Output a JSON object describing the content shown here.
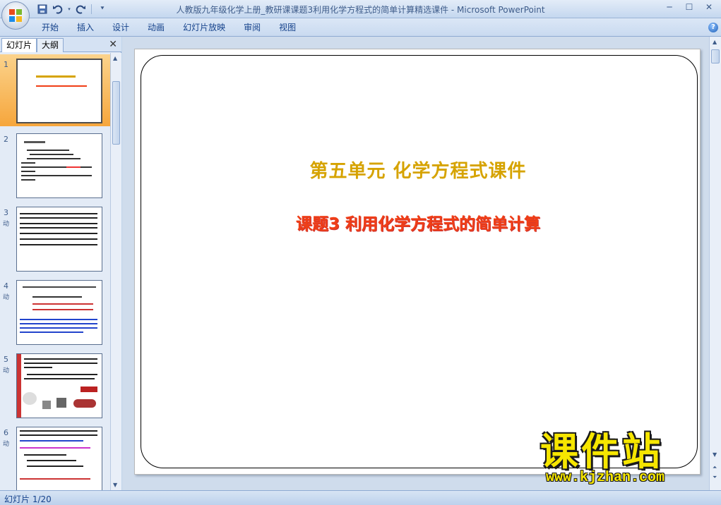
{
  "window": {
    "title": "人教版九年级化学上册_教研课课题3利用化学方程式的简单计算精选课件 - Microsoft PowerPoint"
  },
  "quick_access": [
    "save-icon",
    "undo-icon",
    "redo-icon",
    "customize-icon"
  ],
  "ribbon": {
    "tabs": [
      "开始",
      "插入",
      "设计",
      "动画",
      "幻灯片放映",
      "审阅",
      "视图"
    ]
  },
  "left_panel": {
    "tab_slides": "幻灯片",
    "tab_outline": "大纲",
    "close": "✕",
    "thumbnails": [
      {
        "num": "1",
        "anim": "",
        "selected": true
      },
      {
        "num": "2",
        "anim": "",
        "selected": false
      },
      {
        "num": "3",
        "anim": "动",
        "selected": false
      },
      {
        "num": "4",
        "anim": "动",
        "selected": false
      },
      {
        "num": "5",
        "anim": "动",
        "selected": false
      },
      {
        "num": "6",
        "anim": "动",
        "selected": false
      }
    ]
  },
  "slide": {
    "title": "第五单元 化学方程式课件",
    "subtitle": "课题3 利用化学方程式的简单计算",
    "title_color": "#d6a300",
    "subtitle_color": "#f03e16"
  },
  "watermark": {
    "brand": "课件站",
    "url": "www.kjzhan.com"
  },
  "status_bar": {
    "slide_info": "幻灯片 1/20"
  }
}
